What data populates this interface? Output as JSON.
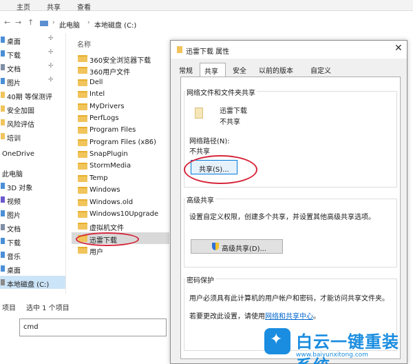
{
  "ribbon": {
    "tabs": [
      "主页",
      "共享",
      "查看"
    ]
  },
  "address": {
    "back": "←",
    "forward": "→",
    "up": "↑",
    "crumbs": [
      "此电脑",
      "本地磁盘 (C:)"
    ],
    "sep": "›"
  },
  "nav": {
    "items": [
      {
        "label": "桌面",
        "pinned": true
      },
      {
        "label": "下载",
        "pinned": true
      },
      {
        "label": "文档",
        "pinned": true
      },
      {
        "label": "图片",
        "pinned": true
      },
      {
        "label": "40期 等保测评",
        "pinned": false
      },
      {
        "label": "安全加固",
        "pinned": false
      },
      {
        "label": "风险评估",
        "pinned": false
      },
      {
        "label": "培训",
        "pinned": false
      },
      {
        "label": "OneDrive",
        "section": true
      },
      {
        "label": "此电脑",
        "section": true
      },
      {
        "label": "3D 对象"
      },
      {
        "label": "视频"
      },
      {
        "label": "图片"
      },
      {
        "label": "文档"
      },
      {
        "label": "下载"
      },
      {
        "label": "音乐"
      },
      {
        "label": "桌面"
      },
      {
        "label": "本地磁盘 (C:)",
        "selected": true
      }
    ],
    "pin_glyph": "✢"
  },
  "files": {
    "column_header": "名称",
    "items": [
      "360安全浏览器下载",
      "360用户文件",
      "Dell",
      "Intel",
      "MyDrivers",
      "PerfLogs",
      "Program Files",
      "Program Files (x86)",
      "SnapPlugin",
      "StormMedia",
      "Temp",
      "Windows",
      "Windows.old",
      "Windows10Upgrade",
      "虚拟机文件",
      "迅雷下载",
      "用户"
    ],
    "selected_index": 15
  },
  "status": {
    "items_label": "项目",
    "selected_label": "选中 1 个项目"
  },
  "cmd": {
    "value": "cmd"
  },
  "dialog": {
    "title": "迅雷下载 属性",
    "close": "✕",
    "tabs": [
      "常规",
      "共享",
      "安全",
      "以前的版本",
      "自定义"
    ],
    "active_tab": "共享",
    "network": {
      "title": "网络文件和文件夹共享",
      "folder_name": "迅雷下载",
      "folder_status": "不共享",
      "path_label": "网络路径(N):",
      "path_value": "不共享",
      "share_button": "共享(S)..."
    },
    "advanced": {
      "title": "高级共享",
      "desc": "设置自定义权限，创建多个共享，并设置其他高级共享选项。",
      "button": "高级共享(D)..."
    },
    "password": {
      "title": "密码保护",
      "desc": "用户必须具有此计算机的用户帐户和密码，才能访问共享文件夹。",
      "change_prefix": "若要更改此设置，请使用",
      "link": "网络和共享中心",
      "change_suffix": "。"
    }
  },
  "watermark": {
    "brand": "白云一键重装系统",
    "url": "www.baiyunxitong.com",
    "bird": "✦"
  },
  "colors": {
    "accent": "#1a8de0",
    "highlight": "#d6263a",
    "folder": "#f1c45c"
  }
}
